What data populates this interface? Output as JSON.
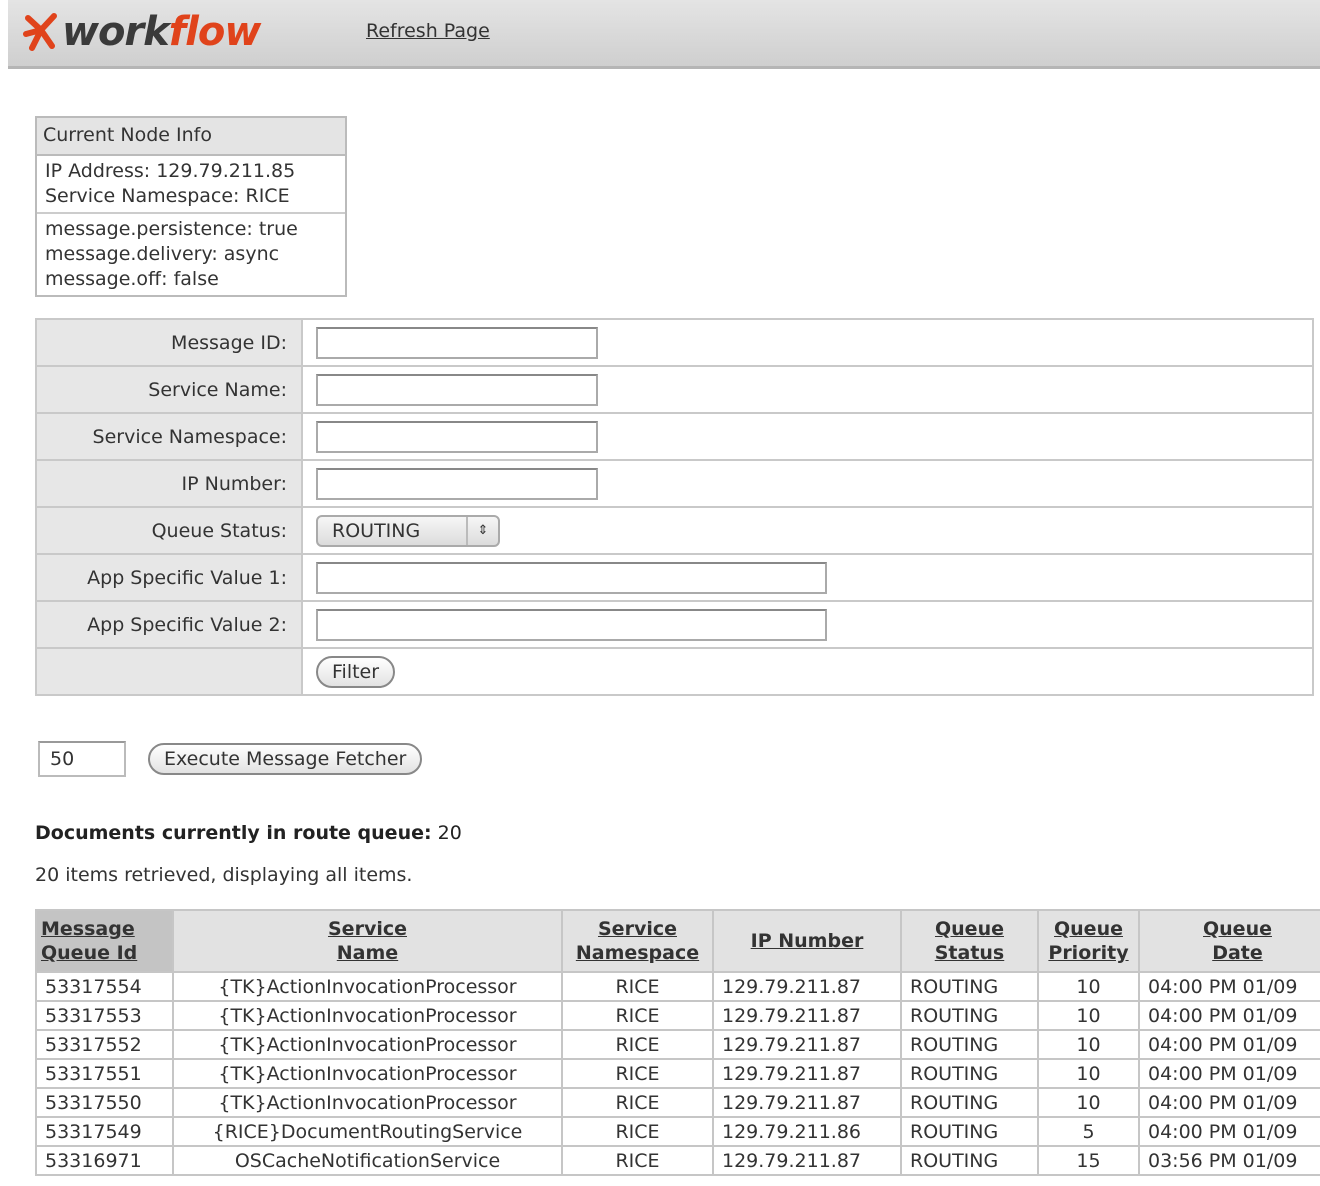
{
  "header": {
    "logo_prefix": "work",
    "logo_accent": "flow",
    "refresh_label": "Refresh Page",
    "logo_star_color": "#e0431b"
  },
  "node_info": {
    "title": "Current Node Info",
    "ip_address": "IP Address: 129.79.211.85",
    "service_namespace": "Service Namespace: RICE",
    "persistence": "message.persistence: true",
    "delivery": "message.delivery: async",
    "off": "message.off: false"
  },
  "filter": {
    "message_id_label": "Message ID:",
    "service_name_label": "Service Name:",
    "service_namespace_label": "Service Namespace:",
    "ip_number_label": "IP Number:",
    "queue_status_label": "Queue Status:",
    "queue_status_value": "ROUTING",
    "app_value_1_label": "App Specific Value 1:",
    "app_value_2_label": "App Specific Value 2:",
    "filter_button": "Filter"
  },
  "fetcher": {
    "count": "50",
    "execute_button": "Execute Message Fetcher"
  },
  "queue": {
    "heading_label": "Documents currently in route queue:",
    "heading_count": "20",
    "retrieved_text": "20 items retrieved, displaying all items."
  },
  "table": {
    "headers": {
      "id_line1": "Message",
      "id_line2": "Queue Id",
      "service_line1": "Service",
      "service_line2": "Name",
      "namespace_line1": "Service",
      "namespace_line2": "Namespace",
      "ip": "IP Number",
      "status_line1": "Queue",
      "status_line2": "Status",
      "priority_line1": "Queue",
      "priority_line2": "Priority",
      "date_line1": "Queue",
      "date_line2": "Date"
    },
    "rows": [
      {
        "id": "53317554",
        "service": "{TK}ActionInvocationProcessor",
        "namespace": "RICE",
        "ip": "129.79.211.87",
        "status": "ROUTING",
        "priority": "10",
        "date": "04:00 PM 01/09"
      },
      {
        "id": "53317553",
        "service": "{TK}ActionInvocationProcessor",
        "namespace": "RICE",
        "ip": "129.79.211.87",
        "status": "ROUTING",
        "priority": "10",
        "date": "04:00 PM 01/09"
      },
      {
        "id": "53317552",
        "service": "{TK}ActionInvocationProcessor",
        "namespace": "RICE",
        "ip": "129.79.211.87",
        "status": "ROUTING",
        "priority": "10",
        "date": "04:00 PM 01/09"
      },
      {
        "id": "53317551",
        "service": "{TK}ActionInvocationProcessor",
        "namespace": "RICE",
        "ip": "129.79.211.87",
        "status": "ROUTING",
        "priority": "10",
        "date": "04:00 PM 01/09"
      },
      {
        "id": "53317550",
        "service": "{TK}ActionInvocationProcessor",
        "namespace": "RICE",
        "ip": "129.79.211.87",
        "status": "ROUTING",
        "priority": "10",
        "date": "04:00 PM 01/09"
      },
      {
        "id": "53317549",
        "service": "{RICE}DocumentRoutingService",
        "namespace": "RICE",
        "ip": "129.79.211.86",
        "status": "ROUTING",
        "priority": "5",
        "date": "04:00 PM 01/09"
      },
      {
        "id": "53316971",
        "service": "OSCacheNotificationService",
        "namespace": "RICE",
        "ip": "129.79.211.87",
        "status": "ROUTING",
        "priority": "15",
        "date": "03:56 PM 01/09"
      }
    ]
  }
}
